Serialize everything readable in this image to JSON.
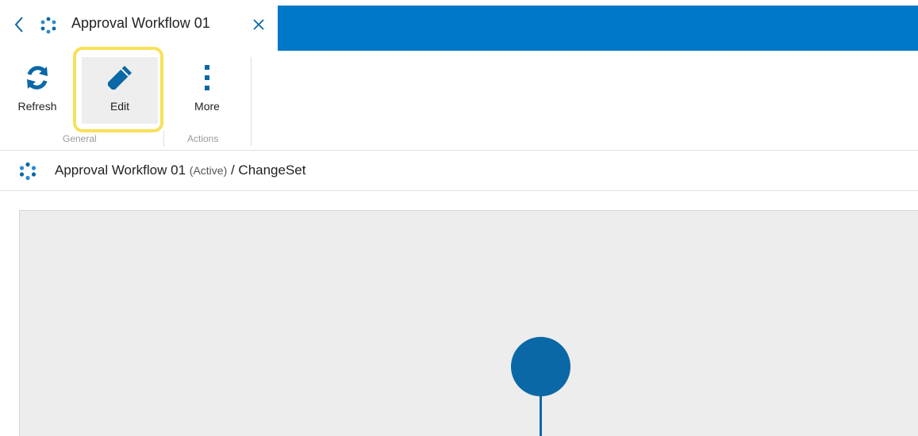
{
  "tab": {
    "title": "Approval Workflow 01",
    "back_icon": "chevron-left-icon",
    "logo_icon": "workflow-dots-icon",
    "close_icon": "close-icon"
  },
  "ribbon": {
    "buttons": [
      {
        "label": "Refresh",
        "icon": "refresh-icon"
      },
      {
        "label": "Edit",
        "icon": "pencil-icon"
      },
      {
        "label": "More",
        "icon": "more-vertical-icon"
      }
    ],
    "groups": [
      "General",
      "Actions"
    ]
  },
  "breadcrumb": {
    "name": "Approval Workflow 01",
    "status": "(Active)",
    "suffix": "/ ChangeSet"
  },
  "colors": {
    "accent": "#0078c8",
    "icon_blue": "#0a68a6",
    "highlight": "#f7e15a",
    "canvas": "#ededed"
  }
}
